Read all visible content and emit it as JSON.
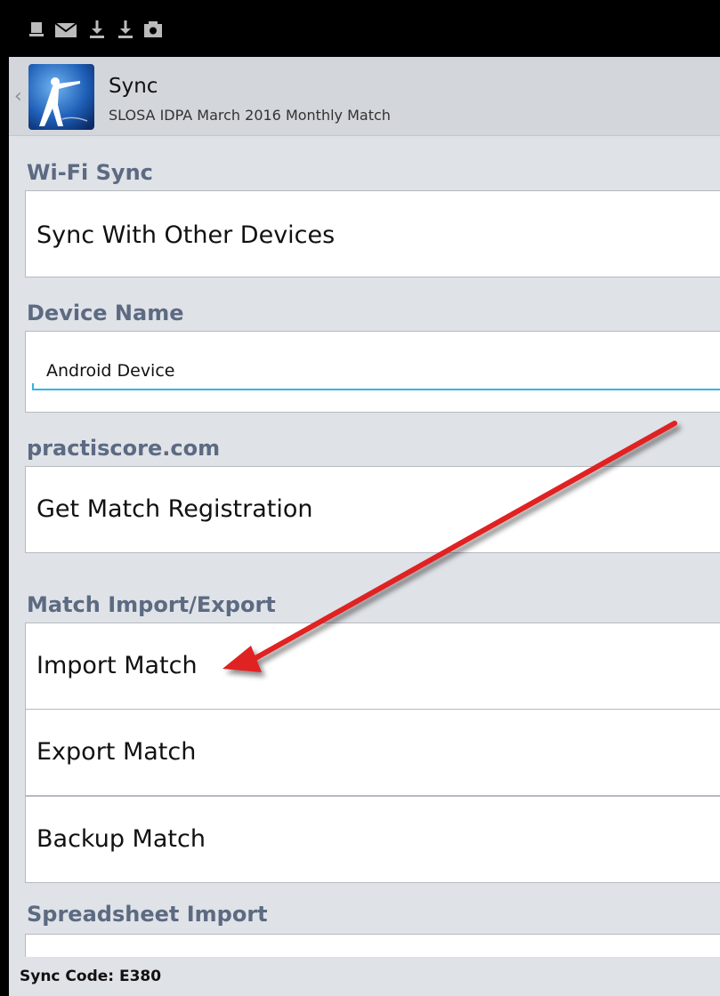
{
  "status_bar": {
    "icons": [
      "notification-icon",
      "mail-icon",
      "download-icon",
      "download-icon",
      "camera-icon"
    ]
  },
  "action_bar": {
    "title": "Sync",
    "subtitle": "SLOSA IDPA March 2016 Monthly Match",
    "app_icon": "shooter-logo-icon",
    "up_icon": "back-caret-icon"
  },
  "sections": {
    "wifi_sync": {
      "header": "Wi-Fi Sync",
      "items": [
        "Sync With Other Devices"
      ]
    },
    "device_name": {
      "header": "Device Name",
      "field_value": "Android Device"
    },
    "practiscore": {
      "header": "practiscore.com",
      "items": [
        "Get Match Registration"
      ]
    },
    "match_import_export": {
      "header": "Match Import/Export",
      "items": [
        "Import Match",
        "Export Match",
        "Backup Match"
      ]
    },
    "spreadsheet_import": {
      "header": "Spreadsheet Import"
    }
  },
  "footer": {
    "sync_code": "Sync Code: E380"
  },
  "colors": {
    "section_header": "#5c6a82",
    "accent": "#33b5e5",
    "annotation_arrow": "#e02020"
  }
}
